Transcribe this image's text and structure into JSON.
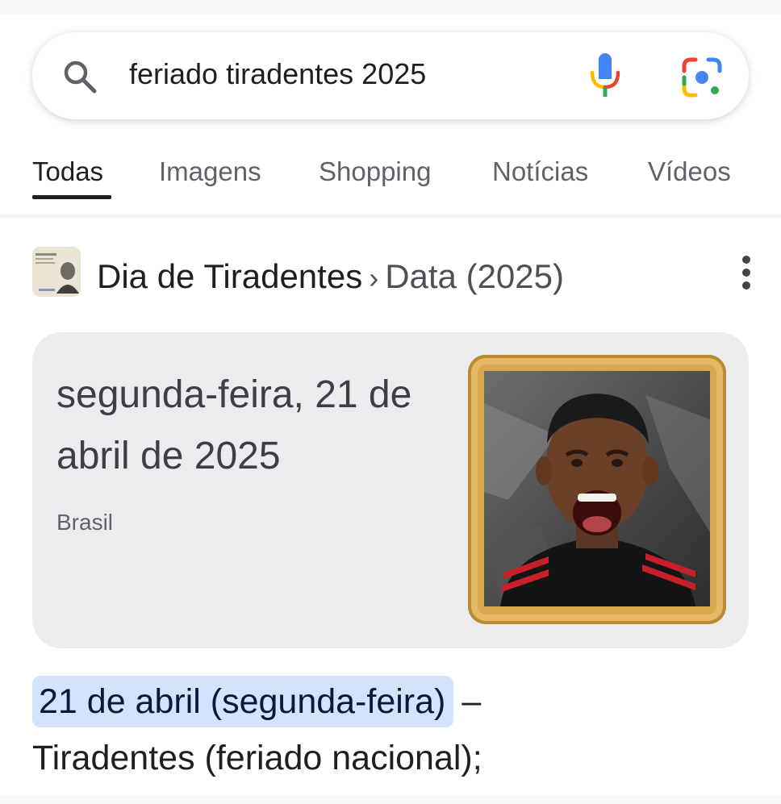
{
  "search": {
    "query": "feriado tiradentes 2025"
  },
  "tabs": [
    {
      "label": "Todas",
      "active": true
    },
    {
      "label": "Imagens",
      "active": false
    },
    {
      "label": "Shopping",
      "active": false
    },
    {
      "label": "Notícias",
      "active": false
    },
    {
      "label": "Vídeos",
      "active": false
    }
  ],
  "result": {
    "breadcrumb_main": "Dia de Tiradentes",
    "breadcrumb_separator": "›",
    "breadcrumb_sub": "Data (2025)",
    "card": {
      "date_text": "segunda-feira, 21 de abril de 2025",
      "country": "Brasil"
    },
    "answer": {
      "highlight": "21 de abril (segunda-feira)",
      "dash": "–",
      "rest": "Tiradentes (feriado nacional);"
    }
  },
  "icons": {
    "search": "search-icon",
    "mic": "mic-icon",
    "lens": "google-lens-icon",
    "more": "more-vert-icon"
  },
  "colors": {
    "highlight_bg": "#d3e3fd",
    "card_bg": "#ececef",
    "frame": "#d9a84d"
  }
}
